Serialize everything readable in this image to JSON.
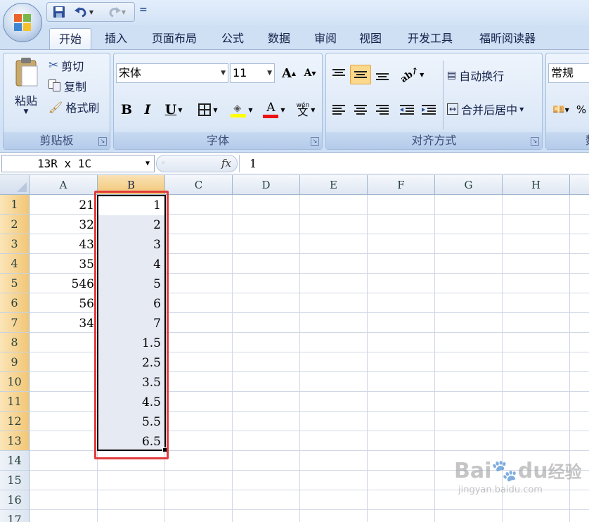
{
  "qat": {
    "save_icon": "save-icon",
    "undo_icon": "undo-icon",
    "redo_icon": "redo-icon",
    "customize": "="
  },
  "tabs": [
    "开始",
    "插入",
    "页面布局",
    "公式",
    "数据",
    "审阅",
    "视图",
    "开发工具",
    "福昕阅读器"
  ],
  "clipboard": {
    "paste": "粘贴",
    "cut": "剪切",
    "copy": "复制",
    "format_painter": "格式刷",
    "label": "剪贴板"
  },
  "font": {
    "name": "宋体",
    "size": "11",
    "grow": "A",
    "shrink": "A",
    "bold": "B",
    "italic": "I",
    "underline": "U",
    "font_color_letter": "A",
    "phonetic": "wén",
    "label": "字体"
  },
  "alignment": {
    "wrap_text": "自动换行",
    "merge_center": "合并后居中",
    "label": "对齐方式"
  },
  "number": {
    "format": "常规",
    "label_partial": "数",
    "percent": "%"
  },
  "formula_bar": {
    "name_box": "13R x 1C",
    "fx": "fx",
    "content": "1"
  },
  "columns": [
    "A",
    "B",
    "C",
    "D",
    "E",
    "F",
    "G",
    "H"
  ],
  "rows": [
    "1",
    "2",
    "3",
    "4",
    "5",
    "6",
    "7",
    "8",
    "9",
    "10",
    "11",
    "12",
    "13",
    "14",
    "15",
    "16",
    "17"
  ],
  "col_a": [
    "21",
    "32",
    "43",
    "35",
    "546",
    "56",
    "34"
  ],
  "col_b": [
    "1",
    "2",
    "3",
    "4",
    "5",
    "6",
    "7",
    "1.5",
    "2.5",
    "3.5",
    "4.5",
    "5.5",
    "6.5"
  ],
  "watermark": {
    "brand": "Bai",
    "brand2": "du",
    "brand3": "经验",
    "url": "jingyan.baidu.com"
  },
  "colors": {
    "selection_border": "#000000",
    "annotation_red": "#e23b3b",
    "selected_fill": "#e6eaf3",
    "header_selected": "#f2c675"
  }
}
